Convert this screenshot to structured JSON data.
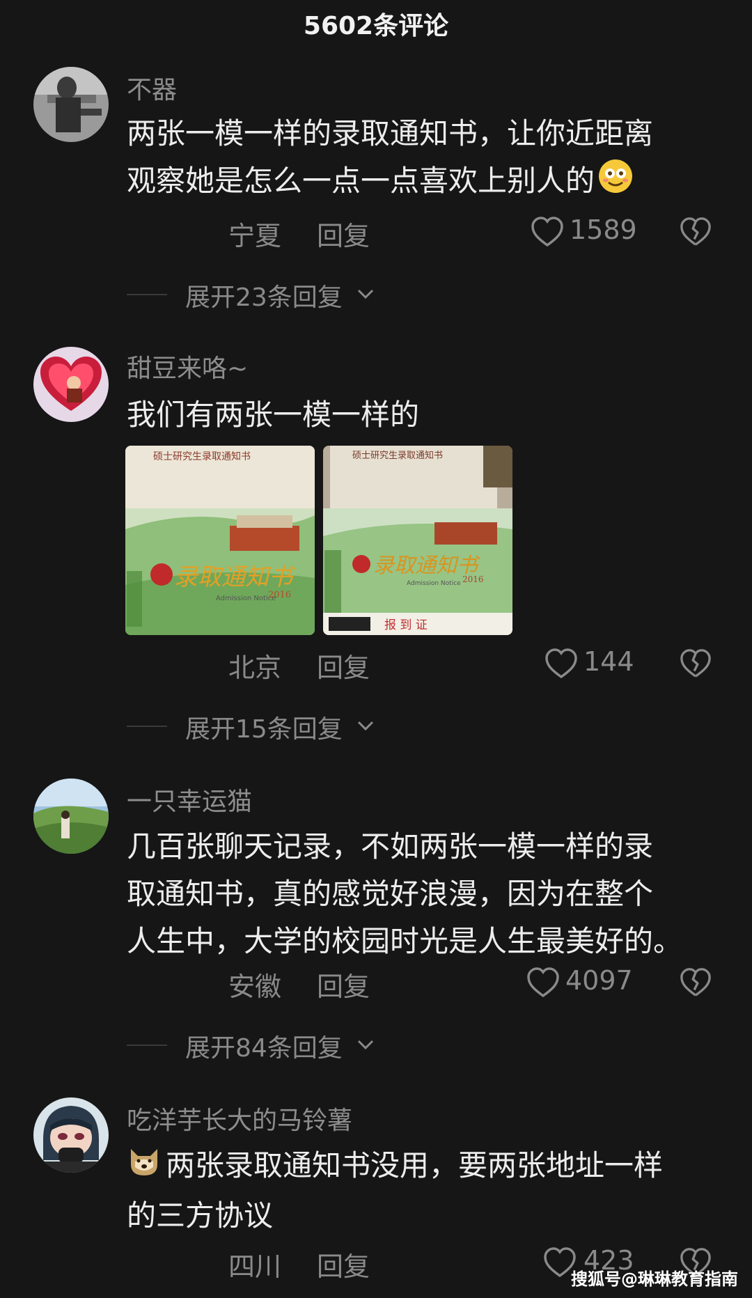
{
  "header": {
    "title": "5602条评论"
  },
  "comments": [
    {
      "user": "不器",
      "text_lines": [
        "两张一模一样的录取通知书，让你近距离",
        "观察她是怎么一点一点喜欢上别人的"
      ],
      "emoji_icon": "smiling-face-icon",
      "region": "宁夏",
      "reply_label": "回复",
      "likes": "1589",
      "expand_label": "展开23条回复"
    },
    {
      "user": "甜豆来咯~",
      "text_lines": [
        "我们有两张一模一样的"
      ],
      "images": [
        {
          "header_text": "硕士研究生录取通知书",
          "brand_text": "录取通知书",
          "en_text": "Admission Notice",
          "year": "2016"
        },
        {
          "header_text": "硕士研究生录取通知书",
          "brand_text": "录取通知书",
          "en_text": "Admission Notice",
          "year": "2016",
          "stamp_text": "报 到 证"
        }
      ],
      "region": "北京",
      "reply_label": "回复",
      "likes": "144",
      "expand_label": "展开15条回复"
    },
    {
      "user": "一只幸运猫",
      "text_lines": [
        "几百张聊天记录，不如两张一模一样的录",
        "取通知书，真的感觉好浪漫，因为在整个",
        "人生中，大学的校园时光是人生最美好的。"
      ],
      "region": "安徽",
      "reply_label": "回复",
      "likes": "4097",
      "expand_label": "展开84条回复"
    },
    {
      "user": "吃洋芋长大的马铃薯",
      "text_lines": [
        "两张录取通知书没用，要两张地址一样",
        "的三方协议"
      ],
      "emoji_icon": "dog-face-icon",
      "region": "四川",
      "reply_label": "回复",
      "likes": "423"
    }
  ],
  "watermark": "搜狐号@琳琳教育指南",
  "colors": {
    "background": "#161616",
    "text": "#ededed",
    "muted": "#8a8a8a"
  }
}
